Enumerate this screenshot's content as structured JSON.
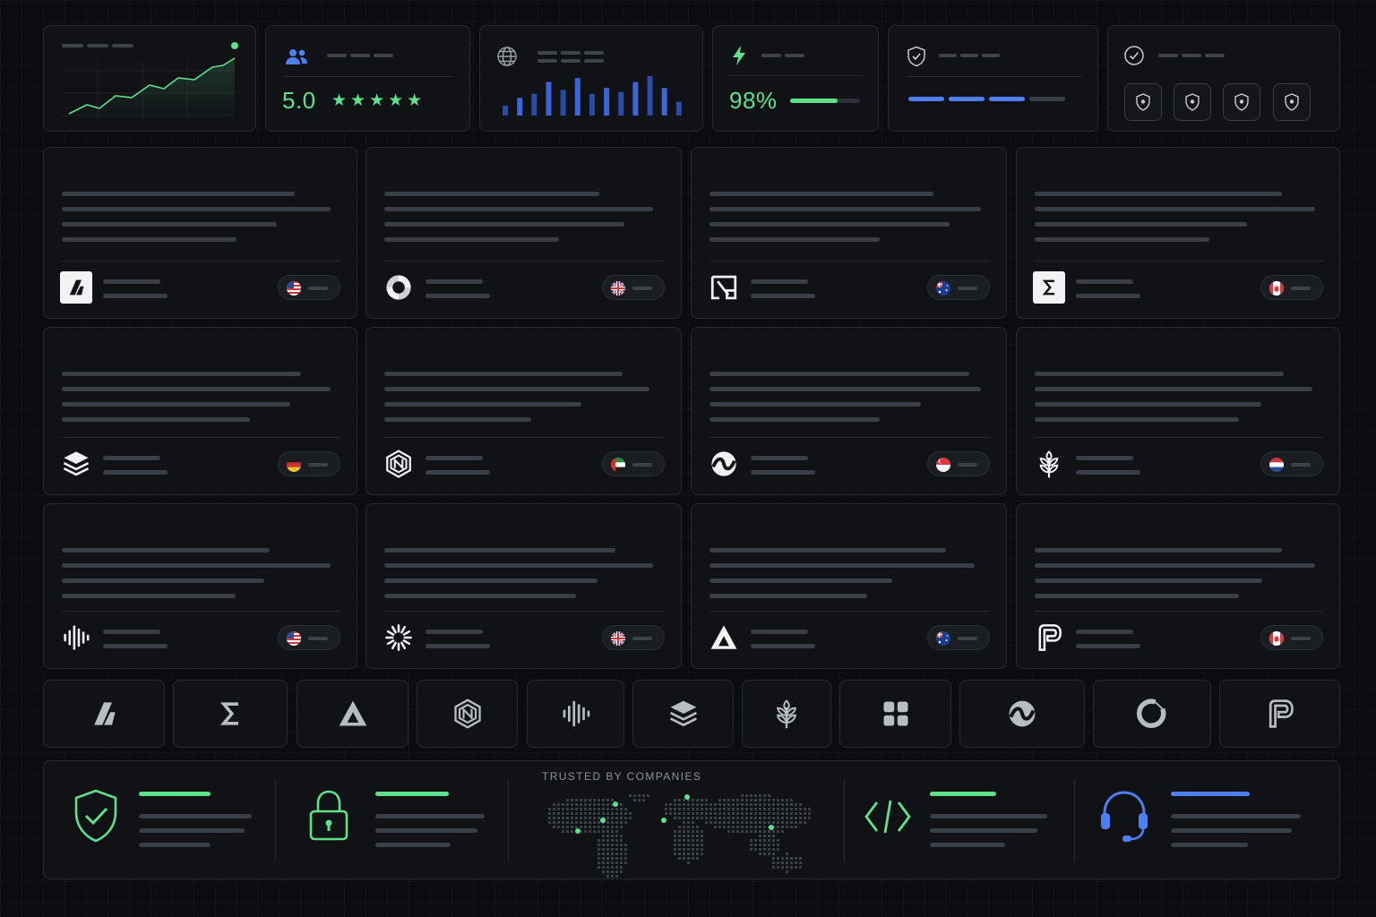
{
  "stats": {
    "rating_value": "5.0",
    "rating_stars": "★★★★★",
    "uptime_value": "98%",
    "uptime_progress": 0.68,
    "bar_chart_values": [
      0.25,
      0.45,
      0.55,
      0.85,
      0.65,
      0.95,
      0.55,
      0.7,
      0.6,
      0.85,
      1.0,
      0.7,
      0.35
    ],
    "security_progress_segments": [
      1,
      1,
      1,
      0
    ]
  },
  "colors": {
    "accent_green": "#5fe08a",
    "accent_blue": "#4f7ef0",
    "card_bg": "#101216",
    "card_border": "#262a31"
  },
  "testimonials": [
    {
      "quote_mark": "“",
      "logo": "bolt-slash-icon",
      "flag": "us-flag-icon"
    },
    {
      "quote_mark": "“",
      "logo": "swirl-ring-icon",
      "flag": "uk-flag-icon"
    },
    {
      "quote_mark": "“",
      "logo": "angular-box-icon",
      "flag": "australia-flag-icon"
    },
    {
      "quote_mark": "“",
      "logo": "s-shape-icon",
      "flag": "canada-flag-icon"
    },
    {
      "quote_mark": "“",
      "logo": "stacked-layers-icon",
      "flag": "germany-flag-icon"
    },
    {
      "quote_mark": "“",
      "logo": "hex-knot-icon",
      "flag": "uae-flag-icon"
    },
    {
      "quote_mark": "“",
      "logo": "wave-circle-icon",
      "flag": "singapore-flag-icon"
    },
    {
      "quote_mark": "“",
      "logo": "leaf-branch-icon",
      "flag": "netherlands-flag-icon"
    },
    {
      "quote_mark": "“",
      "logo": "sound-bars-icon",
      "flag": "us-flag-icon"
    },
    {
      "quote_mark": "“",
      "logo": "radial-burst-icon",
      "flag": "uk-flag-icon"
    },
    {
      "quote_mark": "“",
      "logo": "triangle-a-icon",
      "flag": "australia-flag-icon"
    },
    {
      "quote_mark": "“",
      "logo": "p-loop-icon",
      "flag": "canada-flag-icon"
    }
  ],
  "logo_strip": [
    "bolt-slash-icon",
    "s-shape-icon",
    "triangle-a-icon",
    "hex-knot-icon",
    "sound-bars-icon",
    "stacked-layers-icon",
    "leaf-branch-icon",
    "four-squares-icon",
    "wave-circle-icon",
    "ring-gap-icon",
    "p-loop-icon"
  ],
  "footer": {
    "trusted_label": "TRUSTED BY COMPANIES",
    "features": [
      "shield-check-icon",
      "padlock-icon",
      "code-brackets-icon",
      "headset-icon"
    ]
  }
}
